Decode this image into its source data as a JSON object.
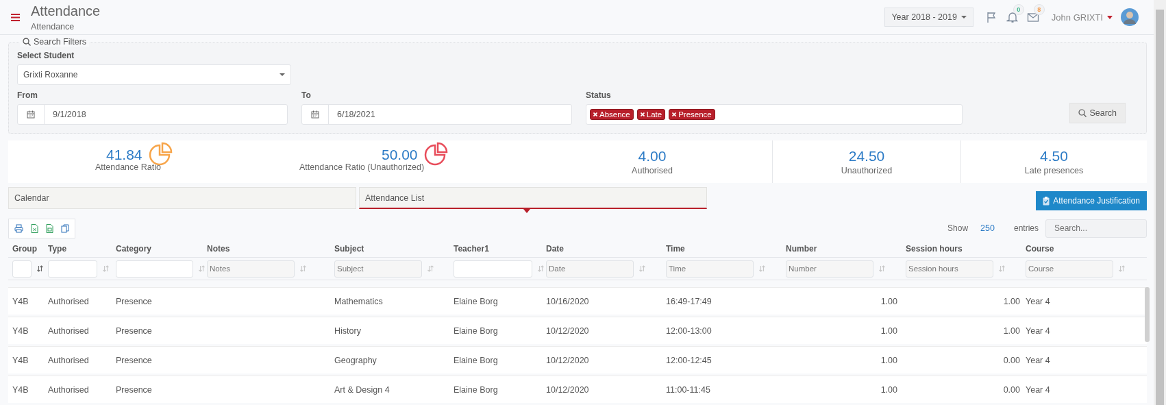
{
  "header": {
    "title": "Attendance",
    "subtitle": "Attendance",
    "year": "Year 2018 - 2019",
    "notifications": [
      {
        "kind": "bell",
        "count": "0",
        "color": "#3bb58a"
      },
      {
        "kind": "mail",
        "count": "8",
        "color": "#f29a4b"
      }
    ],
    "user": "John GRIXTI"
  },
  "filters": {
    "legend": "Search Filters",
    "student_label": "Select Student",
    "student": "Grixti Roxanne",
    "from_label": "From",
    "from": "9/1/2018",
    "to_label": "To",
    "to": "6/18/2021",
    "status_label": "Status",
    "status_tags": [
      "Absence",
      "Late",
      "Presence"
    ],
    "search_button": "Search"
  },
  "stats": [
    {
      "kind": "ratio",
      "value": "41.84",
      "label": "Attendance Ratio",
      "color": "#f7a54a"
    },
    {
      "kind": "ratio",
      "value": "50.00",
      "label": "Attendance Ratio (Unauthorized)",
      "color": "#e84c5a"
    },
    {
      "kind": "count",
      "value": "4.00",
      "label": "Authorised"
    },
    {
      "kind": "count",
      "value": "24.50",
      "label": "Unauthorized"
    },
    {
      "kind": "count",
      "value": "4.50",
      "label": "Late presences"
    }
  ],
  "tabs": [
    {
      "label": "Calendar",
      "selected": false
    },
    {
      "label": "Attendance List",
      "selected": true
    }
  ],
  "justification_button": "Attendance Justification",
  "entries": {
    "show": "Show",
    "count": "250",
    "suffix": "entries",
    "search_placeholder": "Search..."
  },
  "table": {
    "columns": [
      {
        "label": "Group",
        "sorted": true
      },
      {
        "label": "Type",
        "sorted": false
      },
      {
        "label": "Category",
        "sorted": false
      },
      {
        "label": "Notes",
        "placeholder": "Notes",
        "sorted": false
      },
      {
        "label": "Subject",
        "placeholder": "Subject",
        "sorted": false
      },
      {
        "label": "Teacher1",
        "sorted": false
      },
      {
        "label": "Date",
        "placeholder": "Date",
        "sorted": false
      },
      {
        "label": "Time",
        "placeholder": "Time",
        "sorted": false
      },
      {
        "label": "Number",
        "placeholder": "Number",
        "sorted": false
      },
      {
        "label": "Session hours",
        "placeholder": "Session hours",
        "sorted": false
      },
      {
        "label": "Course",
        "placeholder": "Course",
        "sorted": false
      }
    ],
    "rows": [
      [
        "Y4B",
        "Authorised",
        "Presence",
        "",
        "Mathematics",
        "Elaine Borg",
        "10/16/2020",
        "16:49-17:49",
        "1.00",
        "1.00",
        "Year 4"
      ],
      [
        "Y4B",
        "Authorised",
        "Presence",
        "",
        "History",
        "Elaine Borg",
        "10/12/2020",
        "12:00-13:00",
        "1.00",
        "1.00",
        "Year 4"
      ],
      [
        "Y4B",
        "Authorised",
        "Presence",
        "",
        "Geography",
        "Elaine Borg",
        "10/12/2020",
        "12:00-12:45",
        "1.00",
        "0.00",
        "Year 4"
      ],
      [
        "Y4B",
        "Authorised",
        "Presence",
        "",
        "Art & Design 4",
        "Elaine Borg",
        "10/12/2020",
        "11:00-11:45",
        "1.00",
        "0.00",
        "Year 4"
      ]
    ]
  }
}
